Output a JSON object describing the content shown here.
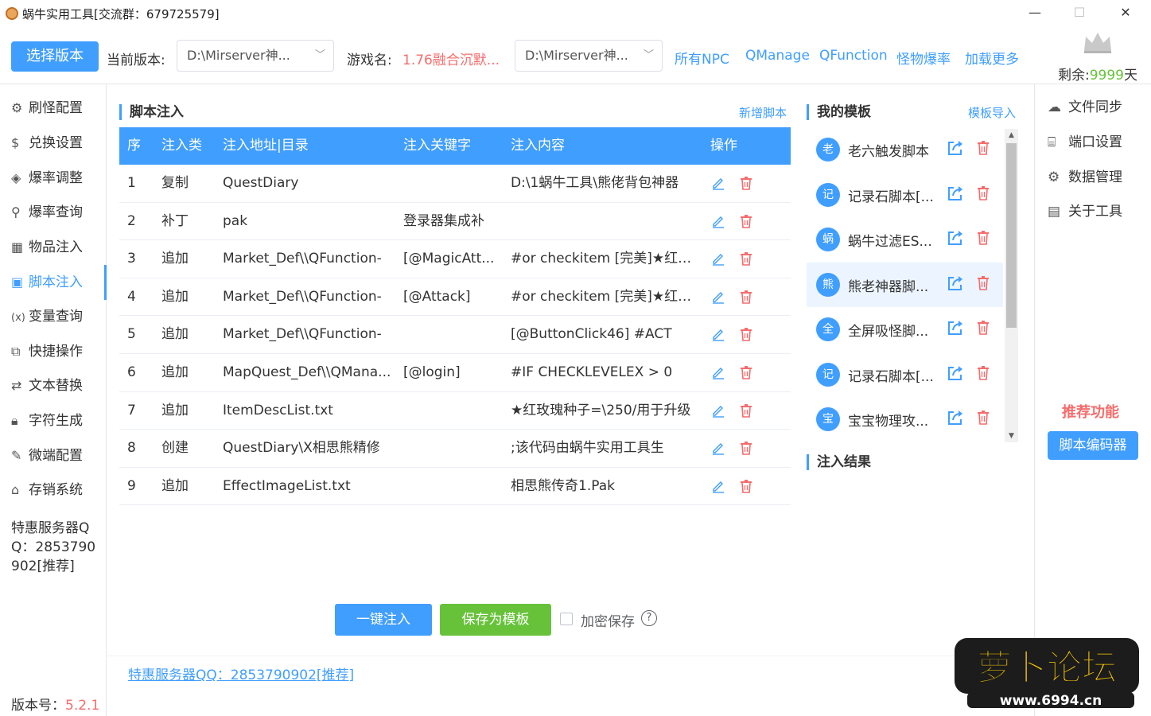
{
  "window": {
    "title": "蜗牛实用工具[交流群：679725579]",
    "minimize": "—",
    "maximize": "☐",
    "close": "✕"
  },
  "toolbar": {
    "select_version_label": "选择版本",
    "current_version_label": "当前版本:",
    "current_version_value": "D:\\Mirserver神...",
    "game_name_label": "游戏名:",
    "game_name_value": "1.76融合沉默...",
    "path_value": "D:\\Mirserver神...",
    "links": [
      "所有NPC",
      "QManage",
      "QFunction",
      "怪物爆率",
      "加载更多"
    ],
    "remaining_label": "剩余:",
    "remaining_value": "9999",
    "remaining_unit": "天"
  },
  "sidebar": {
    "items": [
      {
        "label": "刷怪配置",
        "icon": "robot-icon"
      },
      {
        "label": "兑换设置",
        "icon": "dollar-icon"
      },
      {
        "label": "爆率调整",
        "icon": "cube-icon"
      },
      {
        "label": "爆率查询",
        "icon": "search-icon"
      },
      {
        "label": "物品注入",
        "icon": "grid-icon"
      },
      {
        "label": "脚本注入",
        "icon": "terminal-icon"
      },
      {
        "label": "变量查询",
        "icon": "variable-icon"
      },
      {
        "label": "快捷操作",
        "icon": "external-icon"
      },
      {
        "label": "文本替换",
        "icon": "replace-icon"
      },
      {
        "label": "字符生成",
        "icon": "lock-icon"
      },
      {
        "label": "微端配置",
        "icon": "brush-icon"
      },
      {
        "label": "存销系统",
        "icon": "shop-icon"
      }
    ],
    "server_note": "特惠服务器QQ：2853790902[推荐]",
    "version_label": "版本号：",
    "version_value": "5.2.1"
  },
  "script_inject": {
    "title": "脚本注入",
    "add_link": "新增脚本",
    "columns": [
      "序",
      "注入类",
      "注入地址|目录",
      "注入关键字",
      "注入内容",
      "操作"
    ],
    "rows": [
      [
        "1",
        "复制",
        "QuestDiary",
        "",
        "D:\\1蜗牛工具\\熊佬背包神器"
      ],
      [
        "2",
        "补丁",
        "pak",
        "登录器集成补",
        ""
      ],
      [
        "3",
        "追加",
        "Market_Def\\\\QFunction-",
        "[@MagicAtt...",
        "#or checkitem [完美]★红玫瑰"
      ],
      [
        "4",
        "追加",
        "Market_Def\\\\QFunction-",
        "[@Attack]",
        "#or checkitem [完美]★红玫瑰"
      ],
      [
        "5",
        "追加",
        "Market_Def\\\\QFunction-",
        "",
        "[@ButtonClick46] #ACT"
      ],
      [
        "6",
        "追加",
        "MapQuest_Def\\\\QMana...",
        "[@login]",
        "#IF CHECKLEVELEX > 0"
      ],
      [
        "7",
        "追加",
        "ItemDescList.txt",
        "",
        "★红玫瑰种子=\\250/用于升级"
      ],
      [
        "8",
        "创建",
        "QuestDiary\\X相思熊精修",
        "",
        ";该代码由蜗牛实用工具生"
      ],
      [
        "9",
        "追加",
        "EffectImageList.txt",
        "",
        "相思熊传奇1.Pak"
      ]
    ],
    "inject_btn": "一键注入",
    "save_tpl_btn": "保存为模板",
    "encrypt_label": "加密保存",
    "help": "?"
  },
  "templates": {
    "title": "我的模板",
    "import_link": "模板导入",
    "items": [
      {
        "avatar": "老",
        "name": "老六触发脚本"
      },
      {
        "avatar": "记",
        "name": "记录石脚本[..."
      },
      {
        "avatar": "蜗",
        "name": "蜗牛过滤ES..."
      },
      {
        "avatar": "熊",
        "name": "熊老神器脚..."
      },
      {
        "avatar": "全",
        "name": "全屏吸怪脚..."
      },
      {
        "avatar": "记",
        "name": "记录石脚本[..."
      },
      {
        "avatar": "宝",
        "name": "宝宝物理攻..."
      }
    ],
    "result_title": "注入结果"
  },
  "right_panel": {
    "items": [
      {
        "label": "文件同步",
        "icon": "cloud-upload-icon"
      },
      {
        "label": "端口设置",
        "icon": "port-icon"
      },
      {
        "label": "数据管理",
        "icon": "settings-icon"
      },
      {
        "label": "关于工具",
        "icon": "clipboard-icon"
      }
    ],
    "recommend_label": "推荐功能",
    "editor_btn": "脚本编码器"
  },
  "footer": {
    "link": "特惠服务器QQ：2853790902[推荐]"
  },
  "logo": {
    "text": "萝卜论坛",
    "url_text": "www.6994.cn"
  },
  "colors": {
    "primary": "#409eff",
    "danger": "#f56c6c",
    "success": "#67c23a"
  }
}
